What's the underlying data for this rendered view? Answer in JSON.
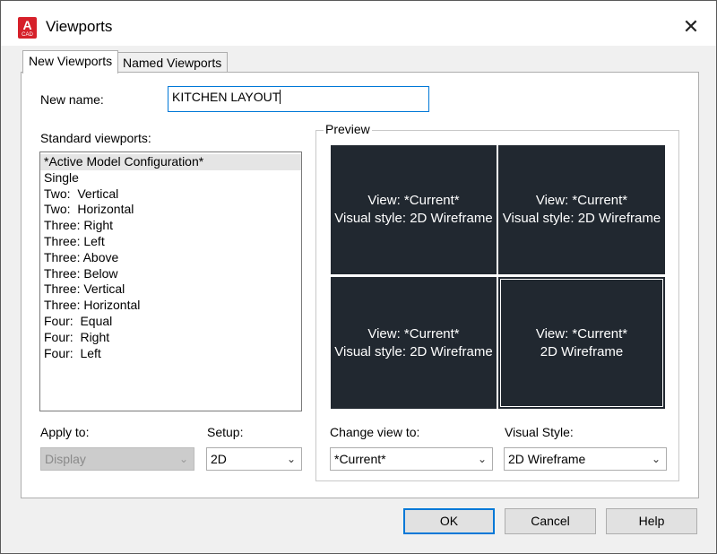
{
  "window": {
    "title": "Viewports",
    "close_glyph": "✕",
    "app_icon_letter": "A",
    "app_icon_sub": "CAD"
  },
  "tabs": [
    {
      "label": "New Viewports",
      "active": true
    },
    {
      "label": "Named Viewports",
      "active": false
    }
  ],
  "new_name": {
    "label": "New name:",
    "value": "KITCHEN LAYOUT"
  },
  "standard_viewports": {
    "label": "Standard viewports:",
    "items": [
      "*Active Model Configuration*",
      "Single",
      "Two:  Vertical",
      "Two:  Horizontal",
      "Three: Right",
      "Three: Left",
      "Three: Above",
      "Three: Below",
      "Three: Vertical",
      "Three: Horizontal",
      "Four:  Equal",
      "Four:  Right",
      "Four:  Left"
    ],
    "selected_index": 0
  },
  "preview": {
    "label": "Preview",
    "viewports": [
      {
        "line1": "View: *Current*",
        "line2": "Visual style: 2D Wireframe"
      },
      {
        "line1": "View: *Current*",
        "line2": "Visual style: 2D Wireframe"
      },
      {
        "line1": "View: *Current*",
        "line2": "Visual style: 2D Wireframe"
      },
      {
        "line1": "View: *Current*",
        "line2": "2D Wireframe"
      }
    ],
    "active_index": 3
  },
  "apply_to": {
    "label": "Apply to:",
    "value": "Display",
    "disabled": true
  },
  "setup": {
    "label": "Setup:",
    "value": "2D"
  },
  "change_view_to": {
    "label": "Change view to:",
    "value": "*Current*"
  },
  "visual_style": {
    "label": "Visual Style:",
    "value": "2D Wireframe"
  },
  "buttons": {
    "ok": "OK",
    "cancel": "Cancel",
    "help": "Help"
  },
  "colors": {
    "accent": "#0078d7",
    "viewport_bg": "#212830",
    "brand_red": "#d6202a"
  }
}
